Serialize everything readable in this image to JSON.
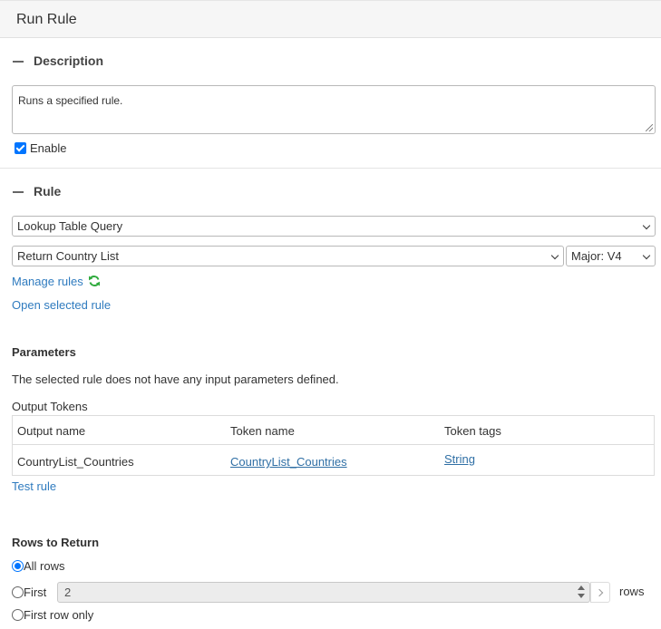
{
  "header": {
    "title": "Run Rule"
  },
  "description_section": {
    "title": "Description",
    "text": "Runs a specified rule.",
    "enable_label": "Enable",
    "enabled": true
  },
  "rule_section": {
    "title": "Rule",
    "rule_type_select": "Lookup Table Query",
    "rule_select": "Return Country List",
    "version_select": "Major: V4",
    "manage_rules_link": "Manage rules",
    "open_rule_link": "Open selected rule"
  },
  "parameters": {
    "heading": "Parameters",
    "message": "The selected rule does not have any input parameters defined."
  },
  "output_tokens": {
    "heading": "Output Tokens",
    "columns": [
      "Output name",
      "Token name",
      "Token tags"
    ],
    "rows": [
      {
        "output_name": "CountryList_Countries",
        "token_name": "CountryList_Countries",
        "token_tags": "String"
      }
    ],
    "test_rule_link": "Test rule"
  },
  "rows_to_return": {
    "heading": "Rows to Return",
    "options": [
      "All rows",
      "First",
      "First row only"
    ],
    "selected": "All rows",
    "first_value": "2",
    "unit": "rows"
  },
  "icons": {
    "collapse": "minus-icon",
    "refresh": "refresh-icon",
    "accent": "#0075ff",
    "refresh_color": "#2eaa3c",
    "link_color": "#2f7bbf"
  }
}
